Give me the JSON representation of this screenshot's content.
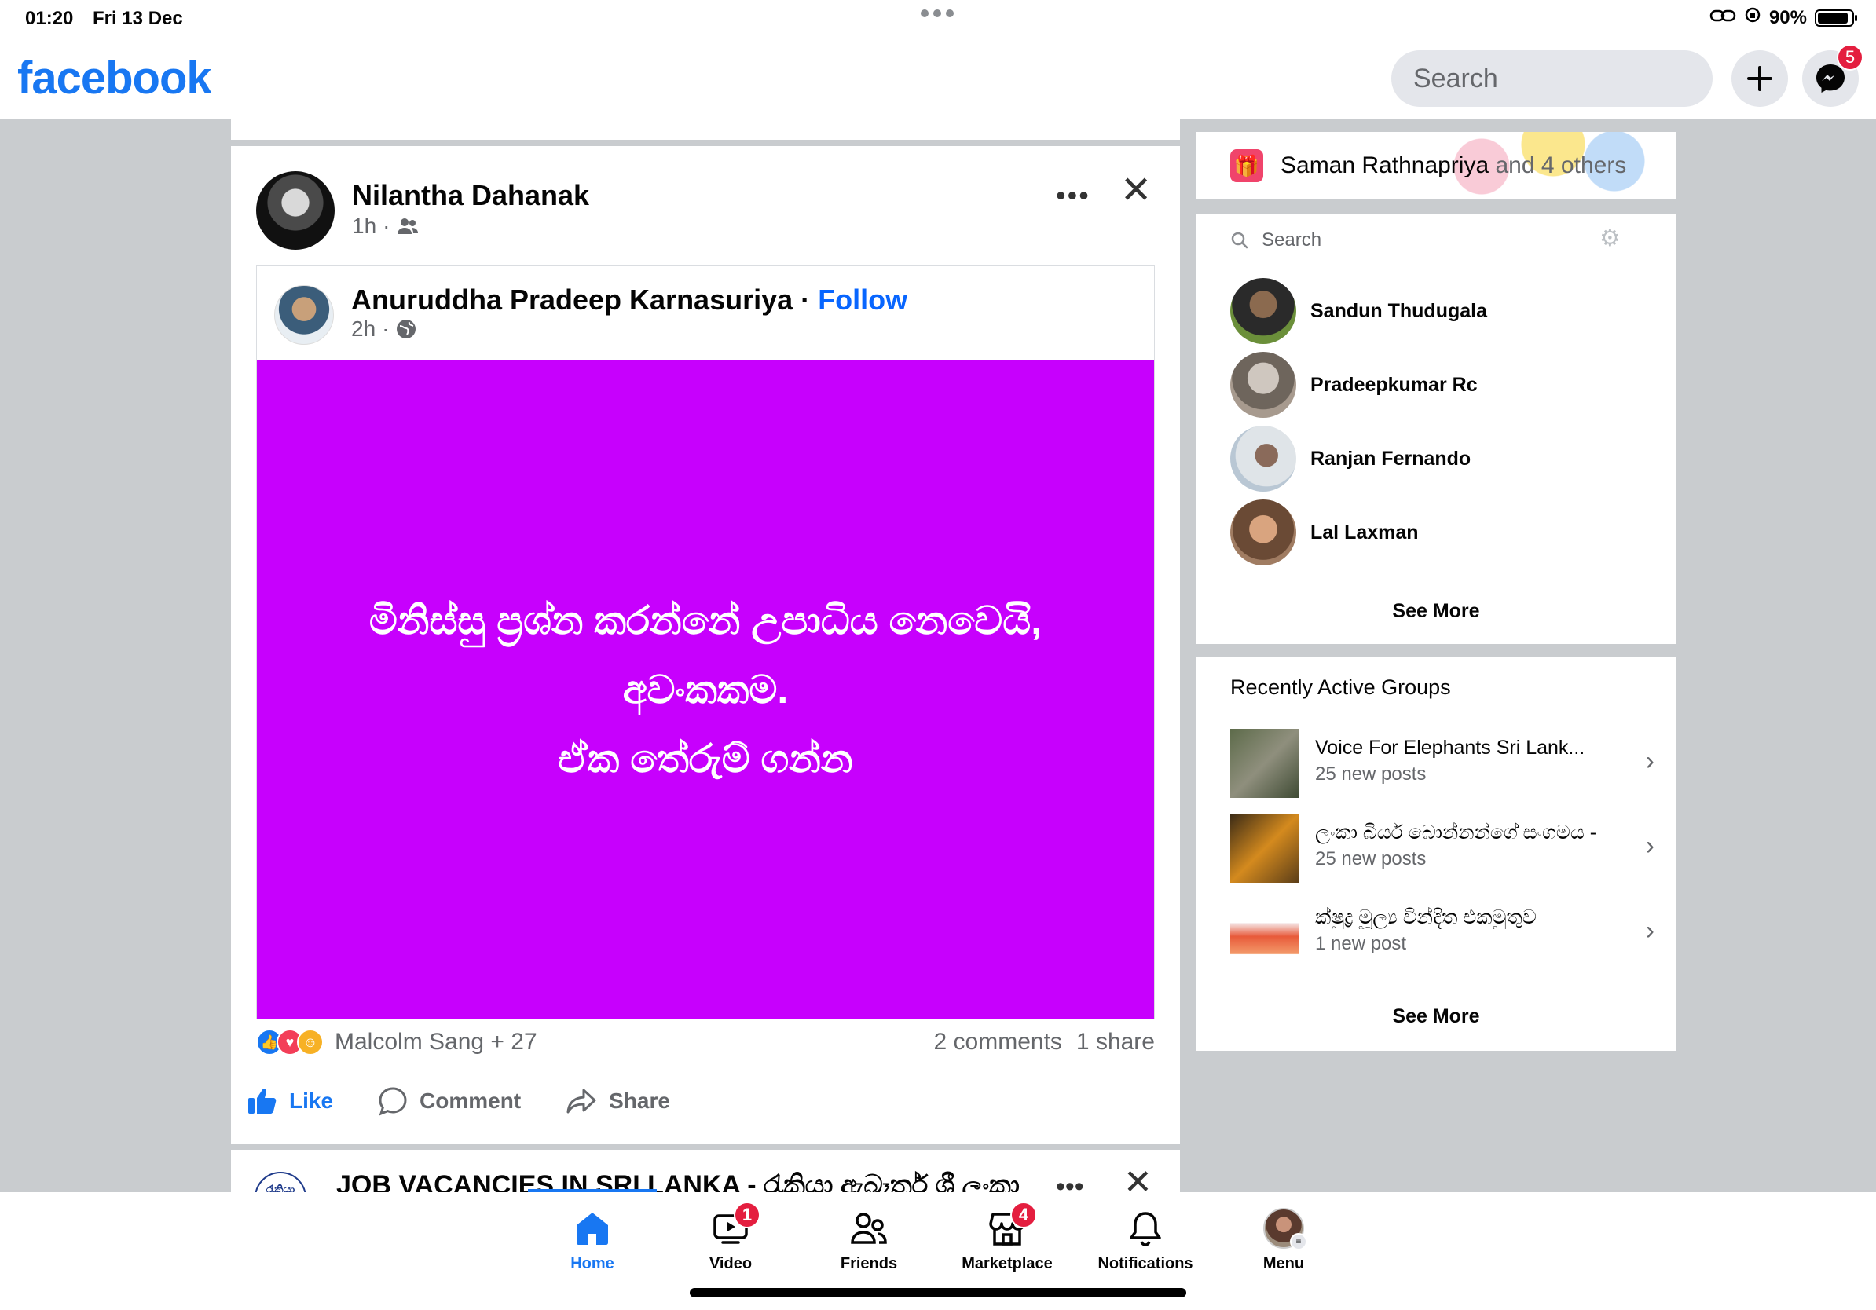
{
  "status_bar": {
    "time": "01:20",
    "date": "Fri 13 Dec",
    "battery": "90%"
  },
  "header": {
    "logo": "facebook",
    "search_placeholder": "Search",
    "messenger_badge": "5"
  },
  "post": {
    "author": "Nilantha Dahanak",
    "time": "1h",
    "audience_icon": "friends-icon",
    "shared": {
      "author": "Anuruddha Pradeep Karnasuriya",
      "separator": "·",
      "follow": "Follow",
      "time": "2h",
      "audience_icon": "globe-icon",
      "background_color": "#c700fd",
      "text_lines": [
        "මිනිස්සු ප්‍රශ්න කරන්නේ උපාධිය නෙවෙයි,",
        "අවංකකම.",
        "ඒක තේරුම් ගන්න"
      ]
    },
    "reactions_text": "Malcolm Sang + 27",
    "comments": "2 comments",
    "shares": "1 share",
    "actions": {
      "like": "Like",
      "comment": "Comment",
      "share": "Share"
    }
  },
  "next_post": {
    "page_logo_text": "රැකියා",
    "title": "JOB VACANCIES IN SRI LANKA - රැකියා ඇබෑර්ත ශ්‍රී ලංකා"
  },
  "birthdays": {
    "name": "Saman Rathnapriya",
    "suffix_and": "and",
    "suffix_others": "4 others"
  },
  "contacts": {
    "search_placeholder": "Search",
    "items": [
      {
        "name": "Sandun Thudugala"
      },
      {
        "name": "Pradeepkumar Rc"
      },
      {
        "name": "Ranjan Fernando"
      },
      {
        "name": "Lal Laxman"
      }
    ],
    "see_more": "See More"
  },
  "groups": {
    "title": "Recently Active Groups",
    "items": [
      {
        "name": "Voice For Elephants Sri Lank...",
        "sub": "25 new posts"
      },
      {
        "name": "ලංකා බියර් බොන්නන්ගේ සංගමය -...",
        "sub": "25 new posts"
      },
      {
        "name": "ක්ෂුද්‍ර මූල්‍ය වින්දිත එකමුතුව",
        "sub": "1 new post"
      }
    ],
    "see_more": "See More"
  },
  "tabs": [
    {
      "label": "Home",
      "active": true
    },
    {
      "label": "Video",
      "badge": "1"
    },
    {
      "label": "Friends"
    },
    {
      "label": "Marketplace",
      "badge": "4"
    },
    {
      "label": "Notifications"
    },
    {
      "label": "Menu"
    }
  ],
  "colors": {
    "brand": "#1877f2",
    "badge": "#e41e3f",
    "post_bg": "#c700fd"
  }
}
